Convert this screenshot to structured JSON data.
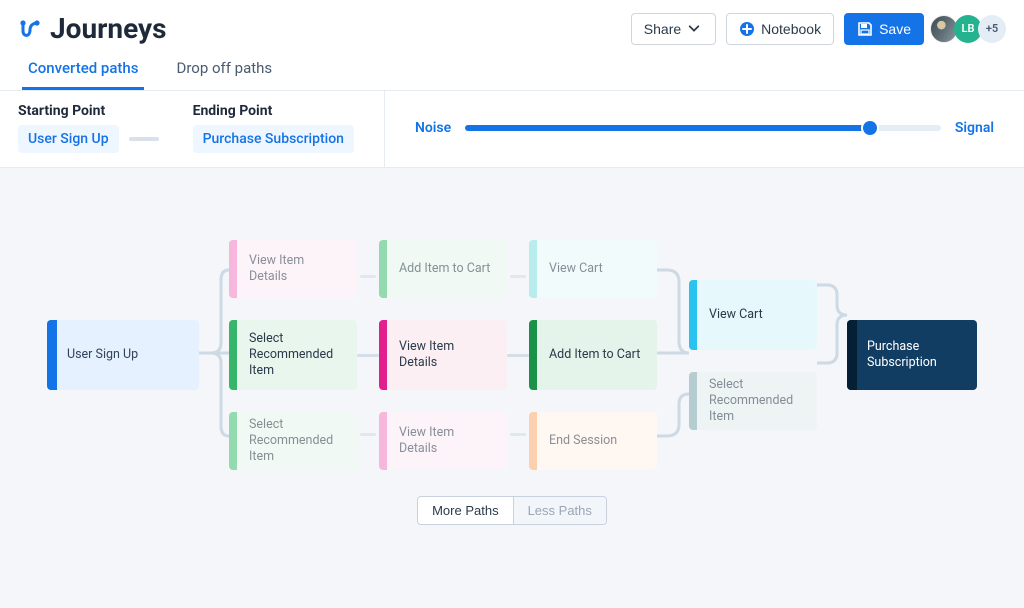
{
  "page_title": "Journeys",
  "header": {
    "share_label": "Share",
    "notebook_label": "Notebook",
    "save_label": "Save",
    "avatar_initials": "LB",
    "avatar_more_label": "+5"
  },
  "tabs": {
    "converted": "Converted paths",
    "dropoff": "Drop off paths"
  },
  "filters": {
    "starting_point_head": "Starting Point",
    "ending_point_head": "Ending Point",
    "starting_point_value": "User Sign Up",
    "ending_point_value": "Purchase Subscription",
    "noise_label": "Noise",
    "signal_label": "Signal"
  },
  "flow": {
    "start": "User Sign Up",
    "end": "Purchase Subscription",
    "stage1": [
      {
        "label": "View Item Details",
        "color": "c-pink",
        "emph": false
      },
      {
        "label": "Select Recommended Item",
        "color": "c-green",
        "emph": true
      },
      {
        "label": "Select Recommended Item",
        "color": "c-green",
        "emph": false
      }
    ],
    "stage2": [
      {
        "label": "Add Item to Cart",
        "color": "c-green",
        "emph": false
      },
      {
        "label": "View Item Details",
        "color": "c-pinkd",
        "emph": true
      },
      {
        "label": "View Item Details",
        "color": "c-pink",
        "emph": false
      }
    ],
    "stage3": [
      {
        "label": "View Cart",
        "color": "c-teal",
        "emph": false
      },
      {
        "label": "Add Item to Cart",
        "color": "c-greend",
        "emph": true
      },
      {
        "label": "End Session",
        "color": "c-orange",
        "emph": false
      }
    ],
    "stage4": [
      {
        "label": "View Cart",
        "color": "c-cyan",
        "emph": true
      },
      {
        "label": "Select Recommended Item",
        "color": "c-bluegr",
        "emph": false
      }
    ]
  },
  "path_buttons": {
    "more": "More Paths",
    "less": "Less Paths"
  }
}
